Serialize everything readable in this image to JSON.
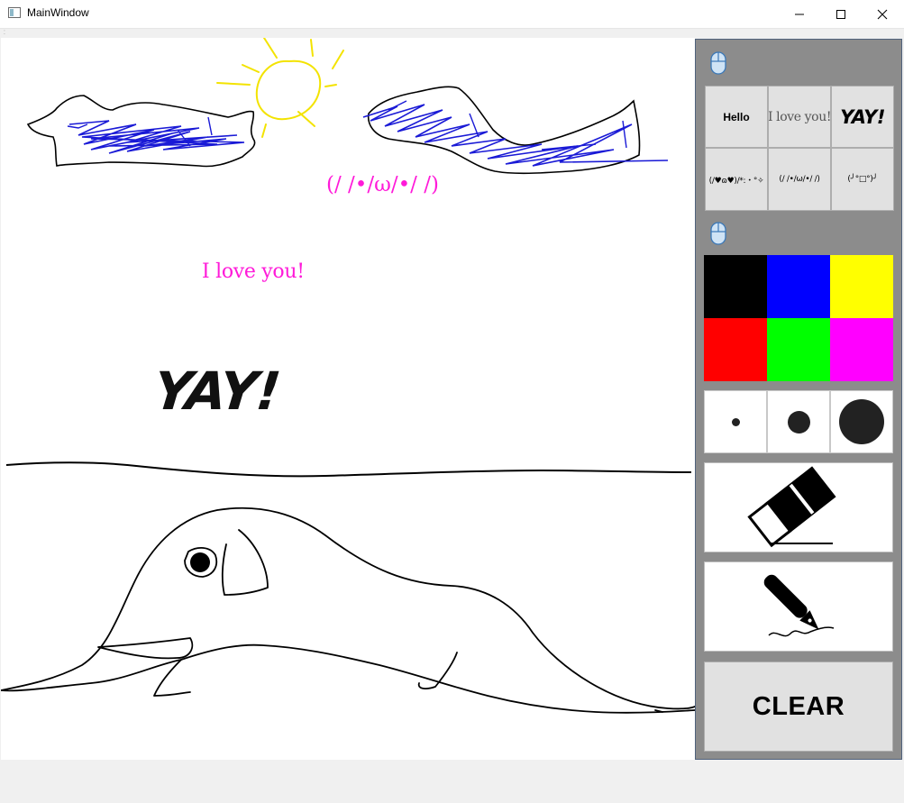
{
  "window": {
    "title": "MainWindow",
    "controls": [
      "minimize",
      "maximize",
      "close"
    ]
  },
  "canvas": {
    "stamps": {
      "kaomoji": "(/ /•/ω/•/ /)",
      "love": "I love you!",
      "yay": "YAY!"
    }
  },
  "panel": {
    "stamp_buttons": [
      {
        "label": "Hello"
      },
      {
        "label": "I love you!"
      },
      {
        "label": "YAY!"
      },
      {
        "label": "(/♥ɷ♥)/*:・°✧"
      },
      {
        "label": "(/ /•/ω/•/ /)"
      },
      {
        "label": "(╯°□°)╯"
      }
    ],
    "colors": [
      "#000000",
      "#0000ff",
      "#ffff00",
      "#ff0000",
      "#00ff00",
      "#ff00ff"
    ],
    "brush_sizes": [
      "small",
      "medium",
      "large"
    ],
    "eraser_icon": "eraser-icon",
    "pen_icon": "fountain-pen-icon",
    "clear_label": "CLEAR"
  }
}
